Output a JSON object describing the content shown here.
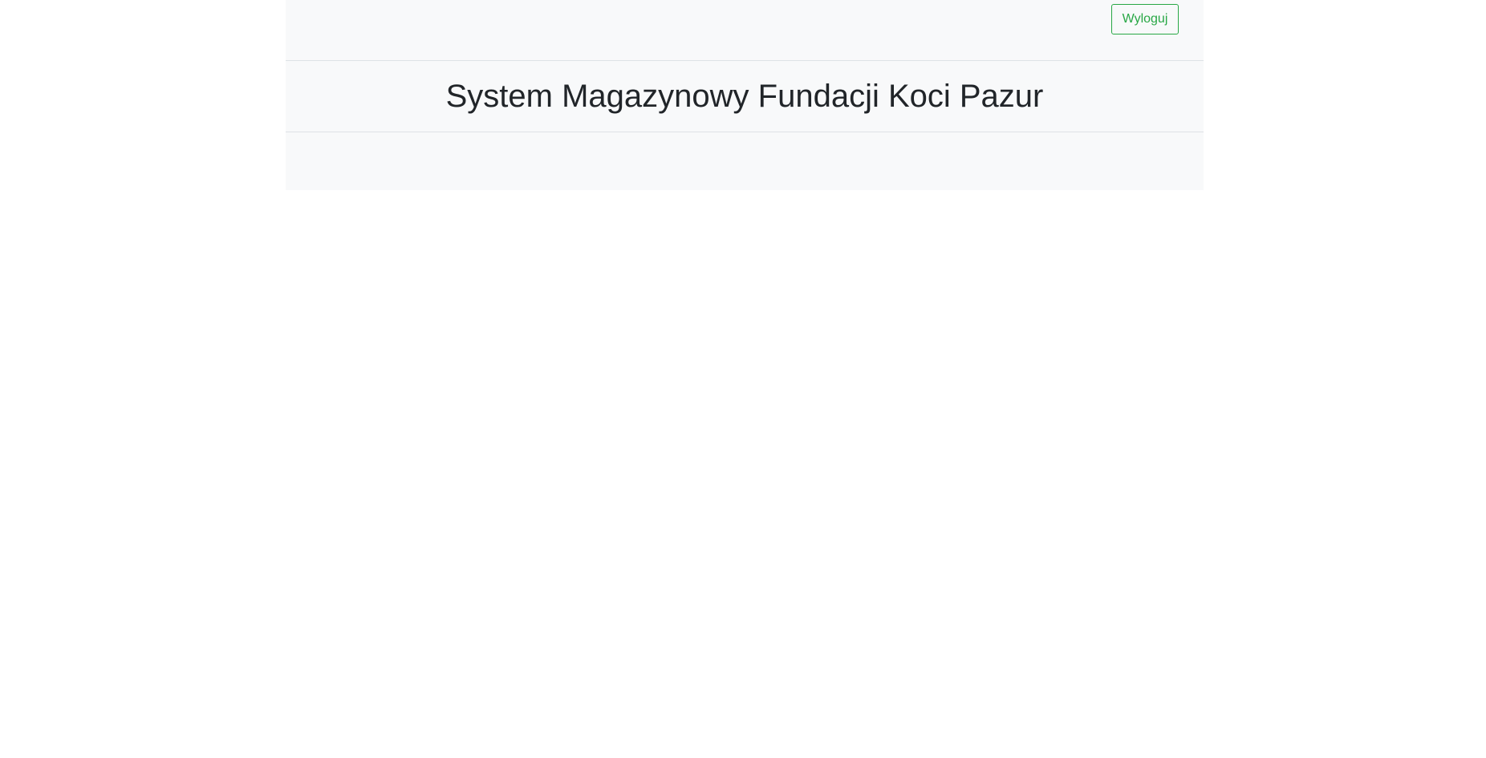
{
  "top_bar": {
    "logout_label": "Wyloguj"
  },
  "header": {
    "title": "System Magazynowy Fundacji Koci Pazur"
  },
  "colors": {
    "accent": "#28a745",
    "panel_background": "#f8f9fa",
    "text": "#212529",
    "border": "#dee2e6"
  }
}
